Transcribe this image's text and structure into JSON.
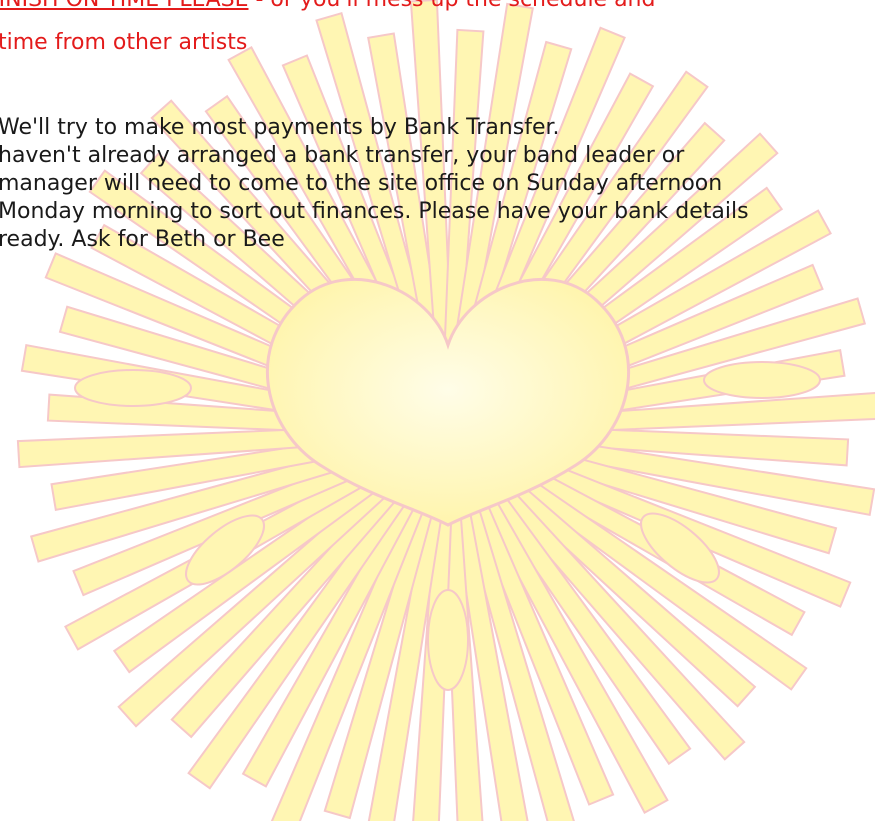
{
  "notice": {
    "warning_emphasis": "FINISH ON TIME PLEASE",
    "warning_rest": " - or you'll mess up the schedule and",
    "warning_line2": "time from other artists"
  },
  "payments": {
    "line1": "We'll try to make most payments by Bank Transfer.",
    "line2": "haven't already arranged a bank transfer, your band leader or",
    "line3": "manager will need to come to the site office on Sunday afternoon",
    "line4": "Monday morning to sort out finances. Please have your bank details",
    "line5": "ready. Ask for Beth or Bee"
  },
  "decoration": {
    "ray_fill": "#fff6b3",
    "ray_stroke": "#f6c8c8",
    "heart_fill_center": "#fffde8",
    "heart_fill_edge": "#fff4a8",
    "heart_stroke": "#f6c8c8",
    "warning_color": "#e31b1b",
    "body_color": "#1a1a1a"
  }
}
